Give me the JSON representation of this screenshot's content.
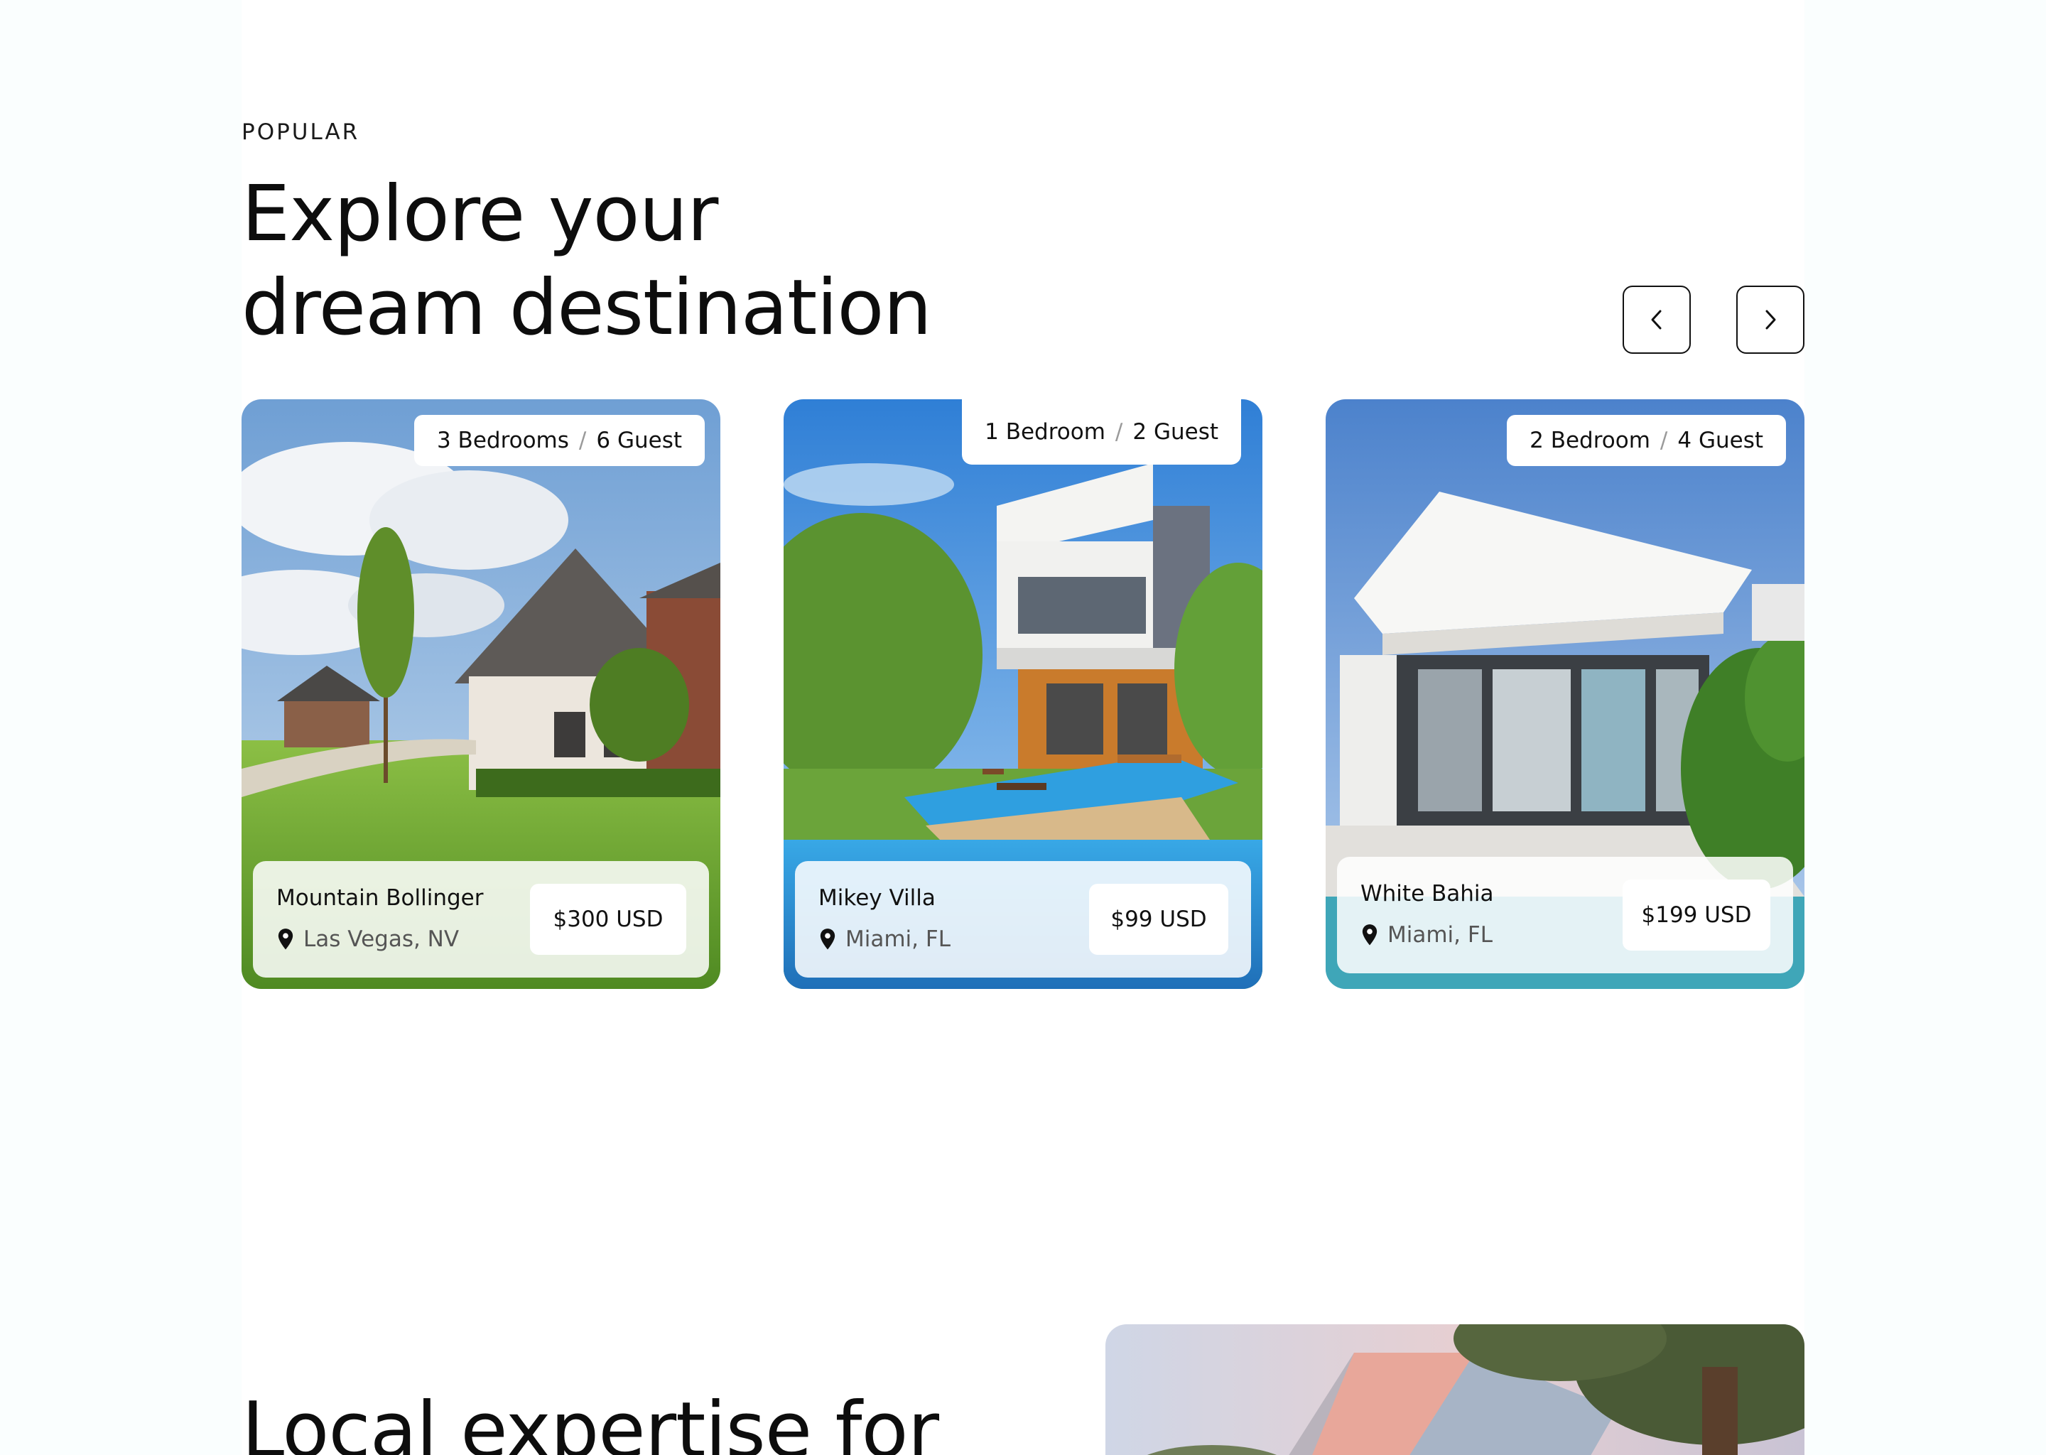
{
  "section": {
    "eyebrow": "POPULAR",
    "headline_line1": "Explore your",
    "headline_line2": "dream destination"
  },
  "carousel": {
    "prev_icon": "chevron-left-icon",
    "next_icon": "chevron-right-icon"
  },
  "cards": [
    {
      "rooms": "3 Bedrooms",
      "separator": "/",
      "guests": "6 Guest",
      "name": "Mountain Bollinger",
      "location": "Las Vegas, NV",
      "price": "$300 USD",
      "icon": "location-pin-icon"
    },
    {
      "rooms": "1 Bedroom",
      "separator": "/",
      "guests": "2 Guest",
      "name": "Mikey Villa",
      "location": "Miami, FL",
      "price": "$99 USD",
      "icon": "location-pin-icon"
    },
    {
      "rooms": "2 Bedroom",
      "separator": "/",
      "guests": "4 Guest",
      "name": "White Bahia",
      "location": "Miami, FL",
      "price": "$199 USD",
      "icon": "location-pin-icon"
    }
  ],
  "next_section": {
    "heading": "Local expertise for"
  },
  "colors": {
    "page_background": "#fafefe",
    "content_background": "#ffffff",
    "text": "#111111",
    "muted_text": "#555555"
  }
}
